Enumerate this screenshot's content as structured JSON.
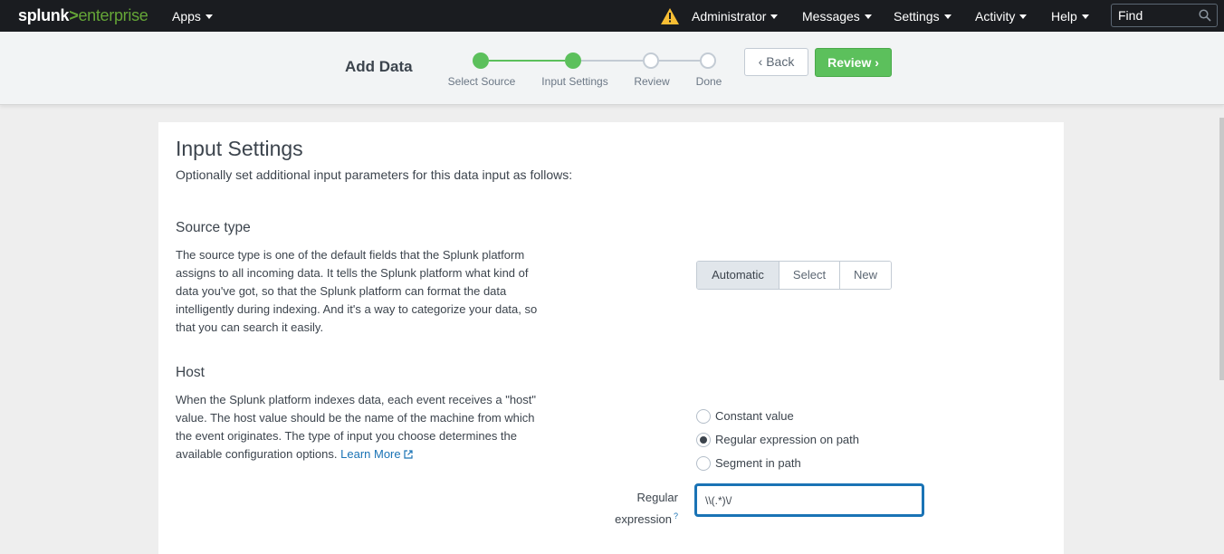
{
  "topbar": {
    "logo_part1": "splunk",
    "logo_part2": ">",
    "logo_part3": "enterprise",
    "apps": "Apps",
    "admin": "Administrator",
    "messages": "Messages",
    "settings": "Settings",
    "activity": "Activity",
    "help": "Help",
    "find_placeholder": "Find",
    "warning_color": "#f8be34"
  },
  "wizard": {
    "title": "Add Data",
    "steps": [
      {
        "label": "Select Source",
        "state": "done"
      },
      {
        "label": "Input Settings",
        "state": "done"
      },
      {
        "label": "Review",
        "state": "todo"
      },
      {
        "label": "Done",
        "state": "todo"
      }
    ],
    "back_label": "Back",
    "review_label": "Review",
    "accent": "#5cc05c"
  },
  "main": {
    "title": "Input Settings",
    "subtitle": "Optionally set additional input parameters for this data input as follows:",
    "source_type": {
      "heading": "Source type",
      "description": "The source type is one of the default fields that the Splunk platform assigns to all incoming data. It tells the Splunk platform what kind of data you've got, so that the Splunk platform can format the data intelligently during indexing. And it's a way to categorize your data, so that you can search it easily.",
      "options": [
        "Automatic",
        "Select",
        "New"
      ],
      "selected": "Automatic"
    },
    "host": {
      "heading": "Host",
      "description": "When the Splunk platform indexes data, each event receives a \"host\" value. The host value should be the name of the machine from which the event originates. The type of input you choose determines the available configuration options.",
      "learn_more": "Learn More",
      "radio_options": [
        "Constant value",
        "Regular expression on path",
        "Segment in path"
      ],
      "selected": "Regular expression on path",
      "regex_label_line1": "Regular",
      "regex_label_line2": "expression",
      "regex_help": "?",
      "regex_value": "\\\\(.*)\\/"
    }
  }
}
